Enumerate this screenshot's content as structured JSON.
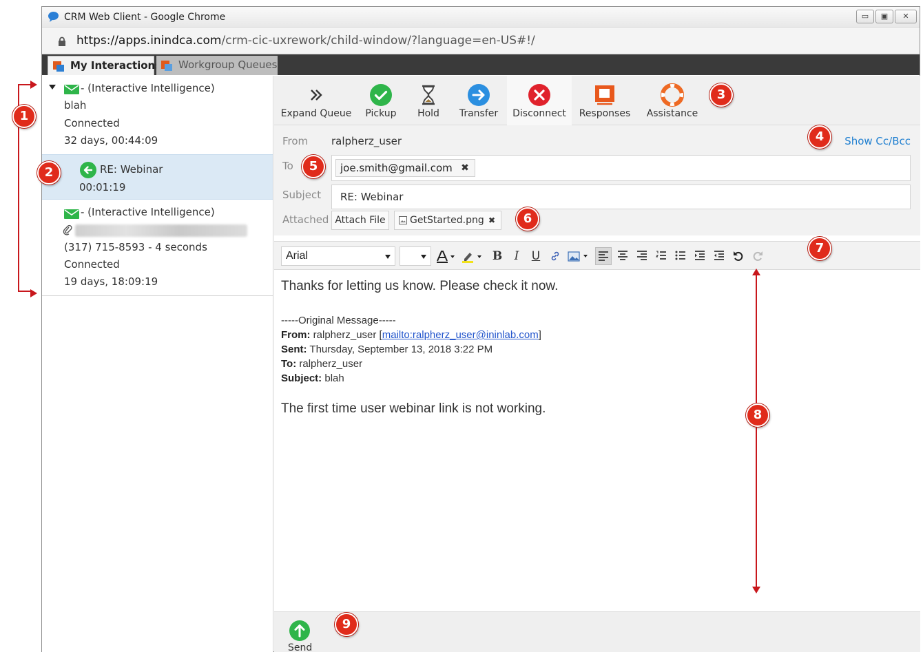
{
  "window": {
    "title": "CRM Web Client - Google Chrome",
    "url_host": "https://apps.inindca.com",
    "url_path": "/crm-cic-uxrework/child-window/?language=en-US#!/"
  },
  "tabs": [
    {
      "label": "My Interactions",
      "active": true
    },
    {
      "label": "Workgroup Queues",
      "active": false
    }
  ],
  "interactions": [
    {
      "title": "- (Interactive Intelligence)",
      "subject": "blah",
      "status": "Connected",
      "duration": "32 days, 00:44:09"
    },
    {
      "title": "RE: Webinar",
      "duration": "00:01:19",
      "selected": true
    },
    {
      "title": "- (Interactive Intelligence)",
      "phone": "(317) 715-8593 - 4 seconds",
      "status": "Connected",
      "duration": "19 days, 18:09:19"
    }
  ],
  "toolbar": [
    {
      "label": "Expand Queue",
      "icon": "double-chevron-right-icon"
    },
    {
      "label": "Pickup",
      "icon": "check-icon"
    },
    {
      "label": "Hold",
      "icon": "hourglass-icon"
    },
    {
      "label": "Transfer",
      "icon": "arrow-right-icon"
    },
    {
      "label": "Disconnect",
      "icon": "close-icon"
    },
    {
      "label": "Responses",
      "icon": "responses-icon"
    },
    {
      "label": "Assistance",
      "icon": "lifebuoy-icon"
    }
  ],
  "email": {
    "from_label": "From",
    "from_value": "ralpherz_user",
    "show_cc_bcc": "Show Cc/Bcc",
    "to_label": "To",
    "to_recipient": "joe.smith@gmail.com",
    "subject_label": "Subject",
    "subject_value": "RE: Webinar",
    "attached_label": "Attached",
    "attach_button": "Attach File",
    "attachment": "GetStarted.png",
    "remove_symbol": "✖"
  },
  "editor": {
    "font": "Arial",
    "body_line1": "Thanks for letting us know.  Please check it now.",
    "orig_header": "-----Original Message-----",
    "orig_from_label": "From:",
    "orig_from_name": "ralpherz_user",
    "orig_from_link": "mailto:ralpherz_user@ininlab.com",
    "orig_sent_label": "Sent:",
    "orig_sent_value": "Thursday, September 13, 2018 3:22 PM",
    "orig_to_label": "To:",
    "orig_to_value": "ralpherz_user",
    "orig_subject_label": "Subject:",
    "orig_subject_value": "blah",
    "body_line2": "The first time user webinar link is not working."
  },
  "footer": {
    "send_label": "Send"
  },
  "callouts": [
    "1",
    "2",
    "3",
    "4",
    "5",
    "6",
    "7",
    "8",
    "9"
  ],
  "colors": {
    "accent_blue": "#1f7fd0",
    "callout_red": "#e02b1b",
    "green": "#2fb54a",
    "selected_row": "#dbe9f5"
  }
}
